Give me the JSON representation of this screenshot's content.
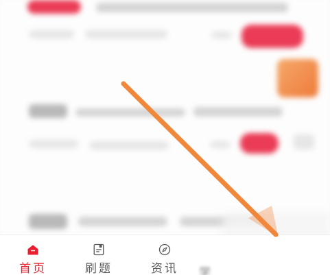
{
  "tabbar": {
    "tabs": [
      {
        "label": "首页",
        "icon": "home-icon",
        "active": true
      },
      {
        "label": "刷题",
        "icon": "notebook-icon",
        "active": false
      },
      {
        "label": "资讯",
        "icon": "compass-icon",
        "active": false
      }
    ],
    "partial_label": "学"
  },
  "colors": {
    "accent_red": "#e8202f",
    "button_red": "#ea3c56",
    "arrow_orange": "#f0883c",
    "badge_orange": "#ee7b3a"
  }
}
